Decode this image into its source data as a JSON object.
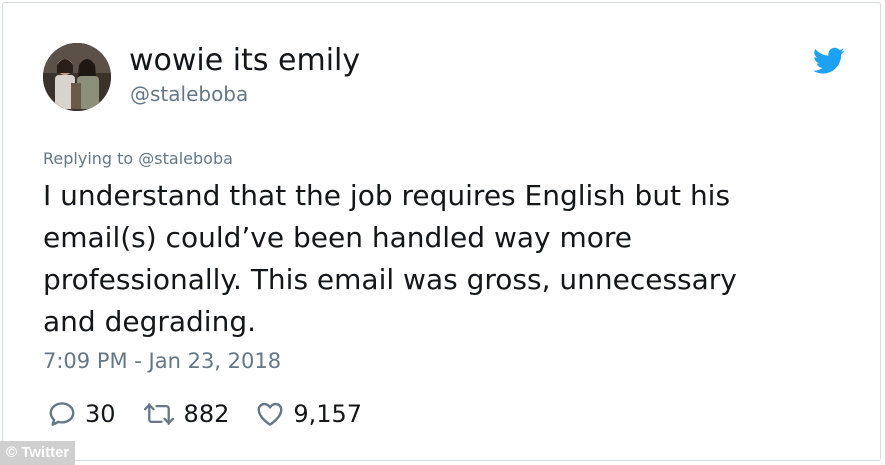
{
  "user": {
    "display_name": "wowie its emily",
    "handle": "@staleboba"
  },
  "brand_icon": "twitter-bird-icon",
  "reply": {
    "text": "Replying to @staleboba"
  },
  "tweet": {
    "lines": [
      "I understand that the job requires English but his",
      "email(s) could’ve been handled way more",
      "professionally. This email was gross, unnecessary",
      "and degrading."
    ],
    "timestamp": "7:09 PM - Jan 23, 2018"
  },
  "actions": {
    "replies": "30",
    "retweets": "882",
    "likes": "9,157"
  },
  "watermark": "© Twitter",
  "colors": {
    "twitter_blue": "#1da1f2",
    "secondary_text": "#657786",
    "primary_text": "#14171a"
  }
}
